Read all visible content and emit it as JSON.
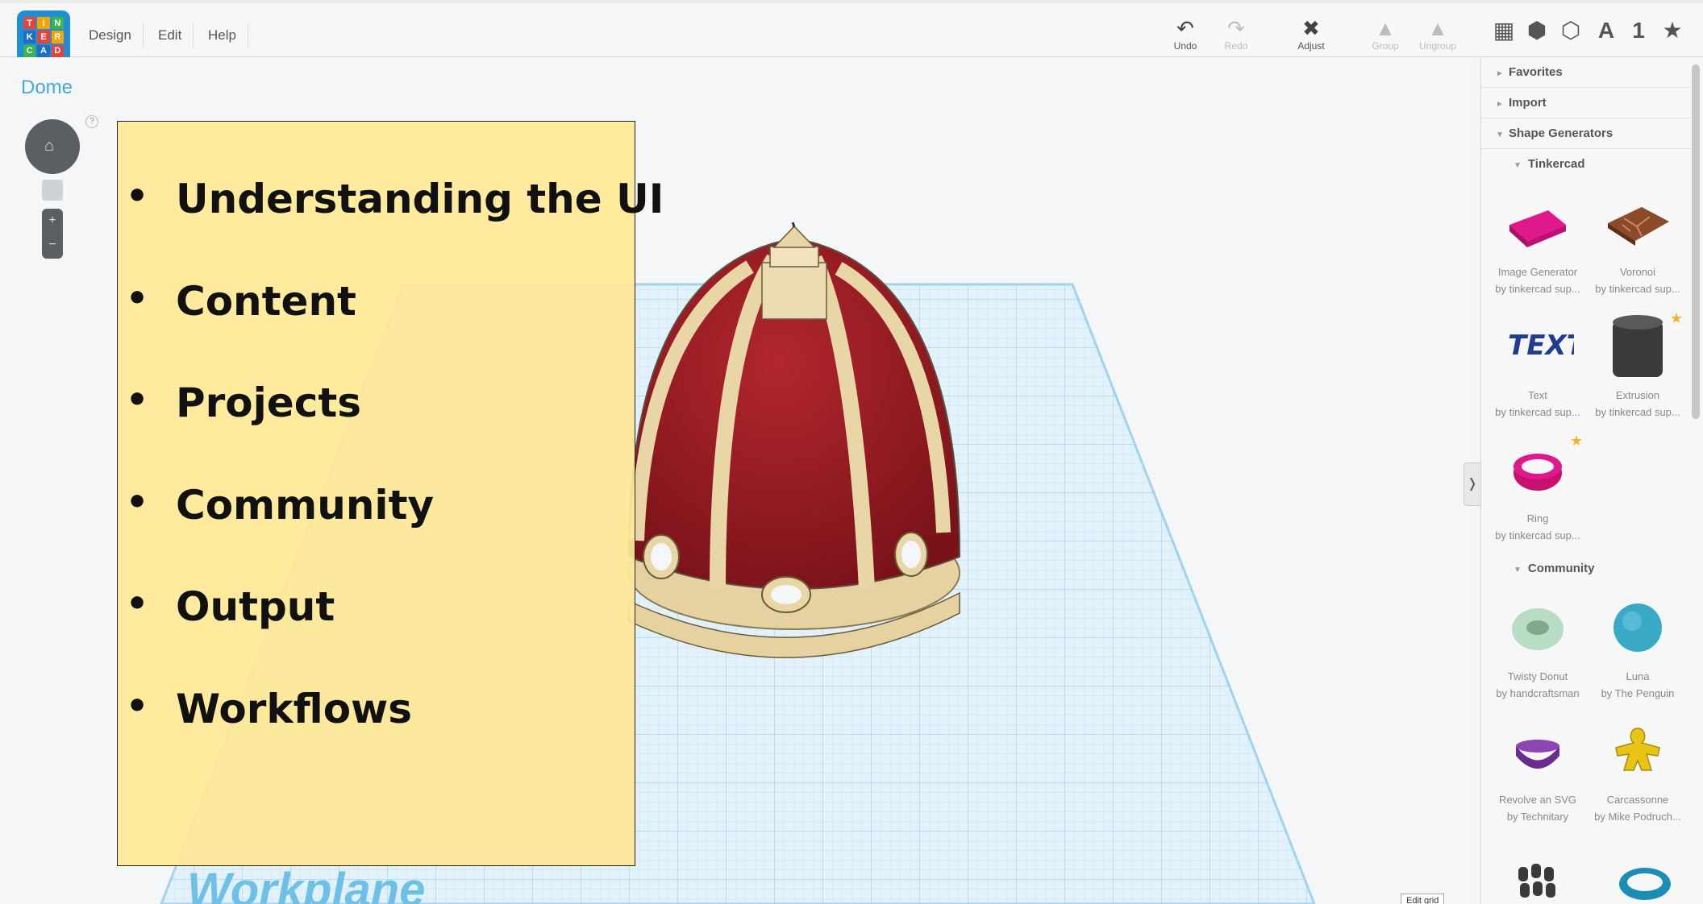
{
  "app": {
    "logo_letters": [
      "T",
      "I",
      "N",
      "K",
      "E",
      "R",
      "C",
      "A",
      "D"
    ],
    "menu": [
      "Design",
      "Edit",
      "Help"
    ]
  },
  "toolbar": {
    "undo": "Undo",
    "redo": "Redo",
    "adjust": "Adjust",
    "group": "Group",
    "ungroup": "Ungroup"
  },
  "view_icons": {
    "text_icon_label": "A",
    "number_icon_label": "1"
  },
  "design": {
    "title": "Dome",
    "help": "?",
    "workplane_label": "Workplane",
    "edit_grid": "Edit grid"
  },
  "overlay": {
    "items": [
      "Understanding the UI",
      "Content",
      "Projects",
      "Community",
      "Output",
      "Workflows"
    ]
  },
  "panel": {
    "sections": [
      "Favorites",
      "Import",
      "Shape Generators"
    ],
    "subsections": [
      "Tinkercad",
      "Community"
    ],
    "tinkercad_shapes": [
      {
        "name": "Image Generator",
        "author": "by tinkercad sup..."
      },
      {
        "name": "Voronoi",
        "author": "by tinkercad sup..."
      },
      {
        "name": "Text",
        "author": "by tinkercad sup..."
      },
      {
        "name": "Extrusion",
        "author": "by tinkercad sup..."
      },
      {
        "name": "Ring",
        "author": "by tinkercad sup..."
      }
    ],
    "community_shapes": [
      {
        "name": "Twisty Donut",
        "author": "by handcraftsman"
      },
      {
        "name": "Luna",
        "author": "by The Penguin"
      },
      {
        "name": "Revolve an SVG",
        "author": "by Technitary"
      },
      {
        "name": "Carcassonne",
        "author": "by Mike Podruch..."
      }
    ]
  },
  "colors": {
    "accent": "#47a9d4",
    "dome_red": "#8e1a22",
    "dome_ribs": "#e9d6a6",
    "grid_blue": "#9fd3ee",
    "overlay_yellow": "#ffe896"
  }
}
